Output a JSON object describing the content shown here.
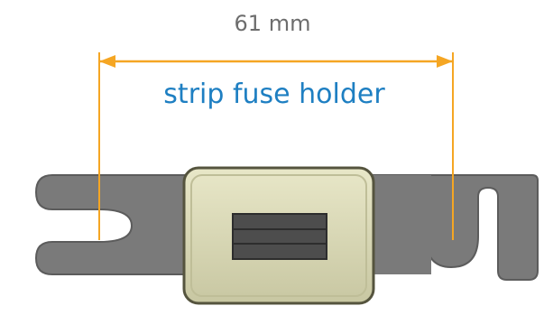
{
  "dimension": {
    "label": "61 mm",
    "arrow_color": "#f5a623"
  },
  "part": {
    "label": "strip fuse holder",
    "label_color": "#1e7fc2",
    "strip_color": "#7a7a7a",
    "body_color": "#d9d8b6",
    "window_color": "#4d4d4d"
  },
  "icons": {
    "left_arrowhead": "arrow-left-icon",
    "right_arrowhead": "arrow-right-icon"
  }
}
